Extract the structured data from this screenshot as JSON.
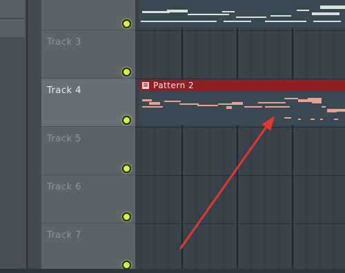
{
  "tracks": [
    {
      "label": "Track 3",
      "active": false
    },
    {
      "label": "Track 4",
      "active": true
    },
    {
      "label": "Track 5",
      "active": false
    },
    {
      "label": "Track 6",
      "active": false
    },
    {
      "label": "Track 7",
      "active": false
    }
  ],
  "pattern": {
    "name": "Pattern 2",
    "icon": "pattern-icon"
  },
  "colors": {
    "pattern": "#8e1f25",
    "led": "#d8f040",
    "arrow": "#e8352c",
    "notes": "#e9a094"
  }
}
